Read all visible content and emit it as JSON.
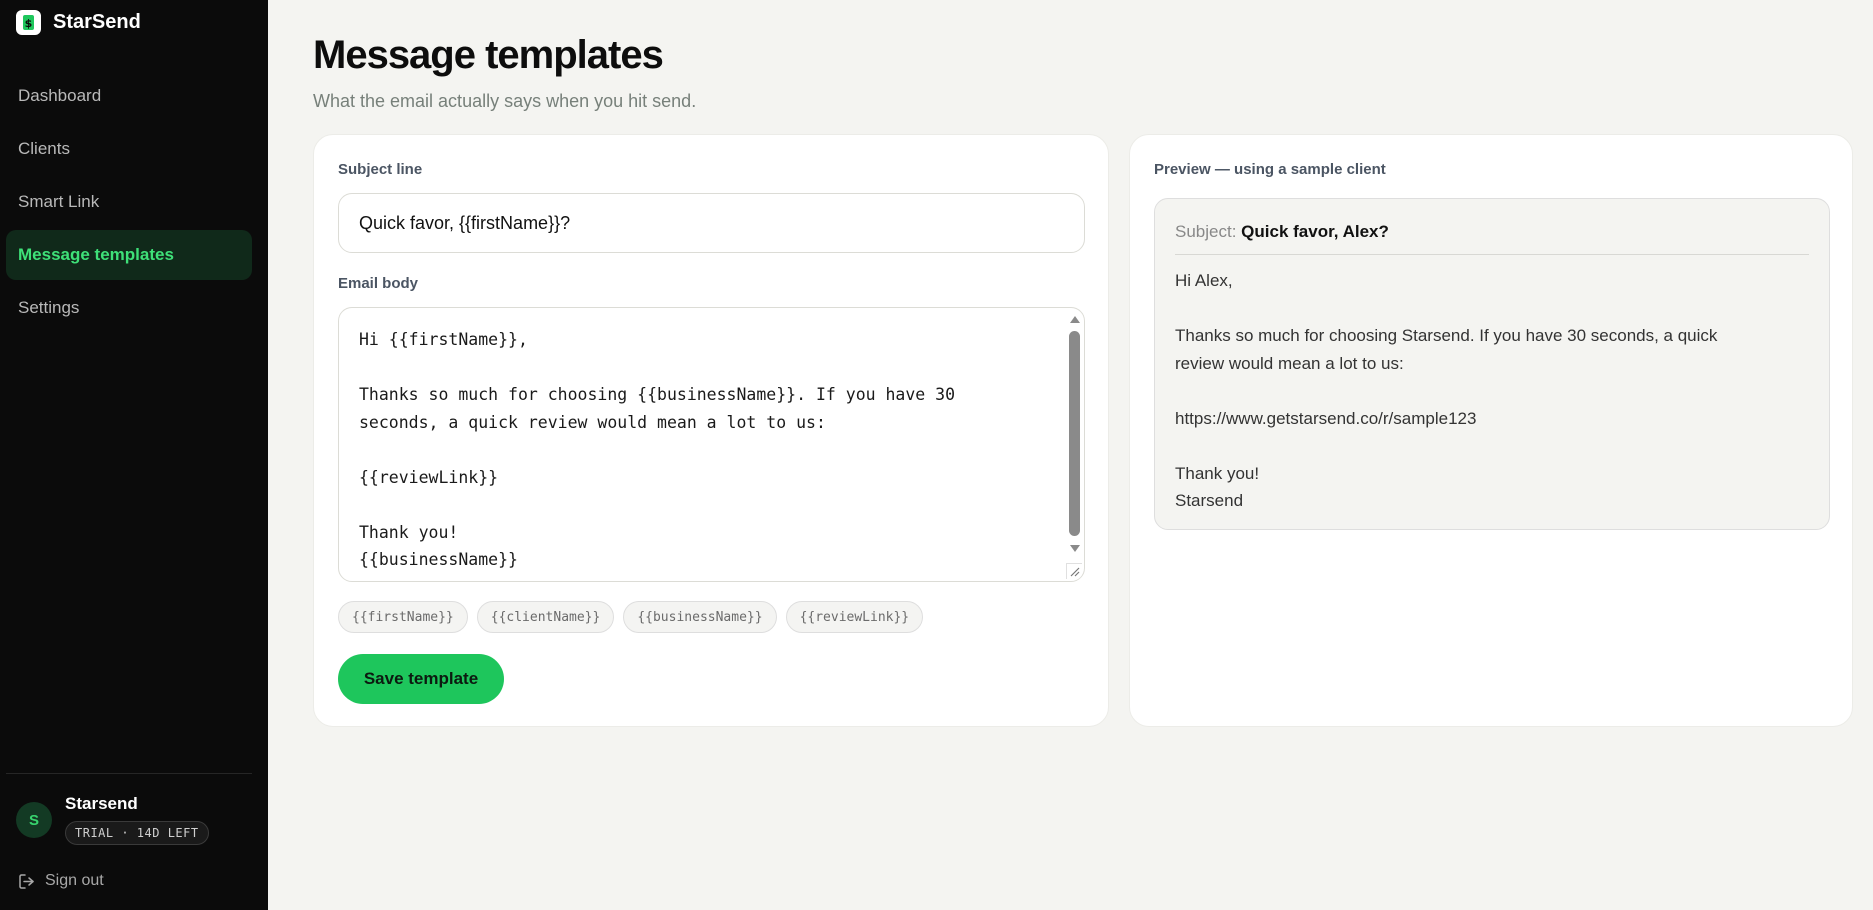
{
  "brand": {
    "name": "StarSend",
    "logo_icon": "dollar-icon"
  },
  "nav": {
    "items": [
      {
        "label": "Dashboard",
        "active": false
      },
      {
        "label": "Clients",
        "active": false
      },
      {
        "label": "Smart Link",
        "active": false
      },
      {
        "label": "Message templates",
        "active": true
      },
      {
        "label": "Settings",
        "active": false
      }
    ]
  },
  "user": {
    "initial": "S",
    "name": "Starsend",
    "badge": "TRIAL · 14D LEFT"
  },
  "signout": {
    "label": "Sign out"
  },
  "page": {
    "title": "Message templates",
    "subtitle": "What the email actually says when you hit send."
  },
  "editor": {
    "subject_label": "Subject line",
    "subject_value": "Quick favor, {{firstName}}?",
    "body_label": "Email body",
    "body_value": "Hi {{firstName}},\n\nThanks so much for choosing {{businessName}}. If you have 30\nseconds, a quick review would mean a lot to us:\n\n{{reviewLink}}\n\nThank you!\n{{businessName}}",
    "variables": [
      "{{firstName}}",
      "{{clientName}}",
      "{{businessName}}",
      "{{reviewLink}}"
    ],
    "save_label": "Save template"
  },
  "preview": {
    "label": "Preview — using a sample client",
    "subject_prefix": "Subject:",
    "subject_value": "Quick favor, Alex?",
    "body": "Hi Alex,\n\nThanks so much for choosing Starsend. If you have 30 seconds, a quick\nreview would mean a lot to us:\n\nhttps://www.getstarsend.co/r/sample123\n\nThank you!\nStarsend"
  },
  "colors": {
    "sidebar_bg": "#0b0b0b",
    "accent": "#1ec65c",
    "active_nav_text": "#3ee078",
    "page_bg": "#f4f4f1"
  }
}
